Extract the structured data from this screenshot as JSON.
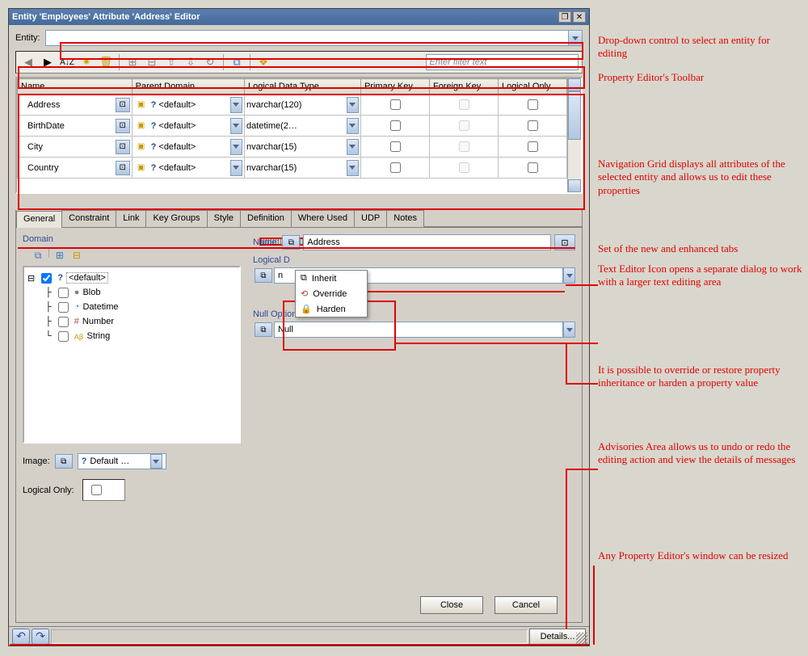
{
  "window": {
    "title": "Entity 'Employees' Attribute 'Address' Editor"
  },
  "entity": {
    "label": "Entity:",
    "value": ""
  },
  "filter": {
    "placeholder": "Enter filter text"
  },
  "grid": {
    "headers": [
      "Name",
      "Parent Domain",
      "Logical Data Type",
      "Primary Key",
      "Foreign Key",
      "Logical Only"
    ],
    "rows": [
      {
        "name": "Address",
        "parent": "<default>",
        "datatype": "nvarchar(120)"
      },
      {
        "name": "BirthDate",
        "parent": "<default>",
        "datatype": "datetime(2…"
      },
      {
        "name": "City",
        "parent": "<default>",
        "datatype": "nvarchar(15)"
      },
      {
        "name": "Country",
        "parent": "<default>",
        "datatype": "nvarchar(15)"
      }
    ]
  },
  "tabs": [
    "General",
    "Constraint",
    "Link",
    "Key Groups",
    "Style",
    "Definition",
    "Where Used",
    "UDP",
    "Notes"
  ],
  "domain": {
    "label": "Domain",
    "root": "<default>",
    "children": [
      "Blob",
      "Datetime",
      "Number",
      "String"
    ]
  },
  "name_section": {
    "label": "Name:",
    "value": "Address"
  },
  "logical_datatype": {
    "label": "Logical D",
    "value_prefix": "n"
  },
  "null_option": {
    "label": "Null Option",
    "value": "Null"
  },
  "popup": {
    "items": [
      "Inherit",
      "Override",
      "Harden"
    ]
  },
  "image": {
    "label": "Image:",
    "value": "Default …"
  },
  "logical_only": {
    "label": "Logical Only:"
  },
  "buttons": {
    "close": "Close",
    "cancel": "Cancel",
    "details": "Details..."
  },
  "annotations": {
    "a1": "Drop-down control to select an entity for editing",
    "a2": "Property Editor's Toolbar",
    "a3": "Navigation Grid displays all attributes of the selected entity and allows us to edit these properties",
    "a4": "Set of the new and enhanced tabs",
    "a5": "Text Editor Icon opens a separate dialog to work with a larger text editing area",
    "a6": "It is possible to override or restore property inheritance or harden a property value",
    "a7": "Advisories Area allows us to undo or redo the editing action and view the details of messages",
    "a8": "Any Property Editor's window can be resized"
  }
}
